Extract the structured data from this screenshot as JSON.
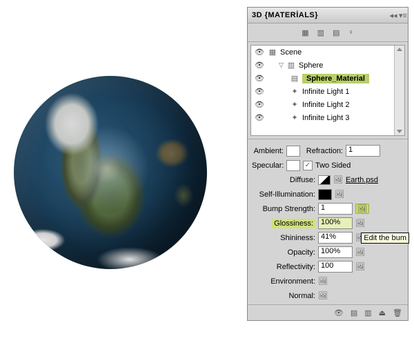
{
  "panel": {
    "title": "3D {MATERİALS}"
  },
  "tree": {
    "root": "Scene",
    "sphere": "Sphere",
    "material": "Sphere_Material",
    "light1": "Infinite Light 1",
    "light2": "Infinite Light 2",
    "light3": "Infinite Light 3"
  },
  "props": {
    "ambient": "Ambient:",
    "refraction_label": "Refraction:",
    "refraction": "1",
    "specular": "Specular:",
    "two_sided": "Two Sided",
    "diffuse": "Diffuse:",
    "diffuse_file": "Earth.psd",
    "self_illum": "Self-Illumination:",
    "bump_label": "Bump Strength:",
    "bump": "1",
    "gloss_label": "Glossiness:",
    "gloss": "100%",
    "shine_label": "Shininess:",
    "shine": "41%",
    "opacity_label": "Opacity:",
    "opacity": "100%",
    "reflect_label": "Reflectivity:",
    "reflect": "100",
    "env": "Environment:",
    "normal": "Normal:"
  },
  "tooltip": "Edit the bum",
  "checkmark": "✓"
}
